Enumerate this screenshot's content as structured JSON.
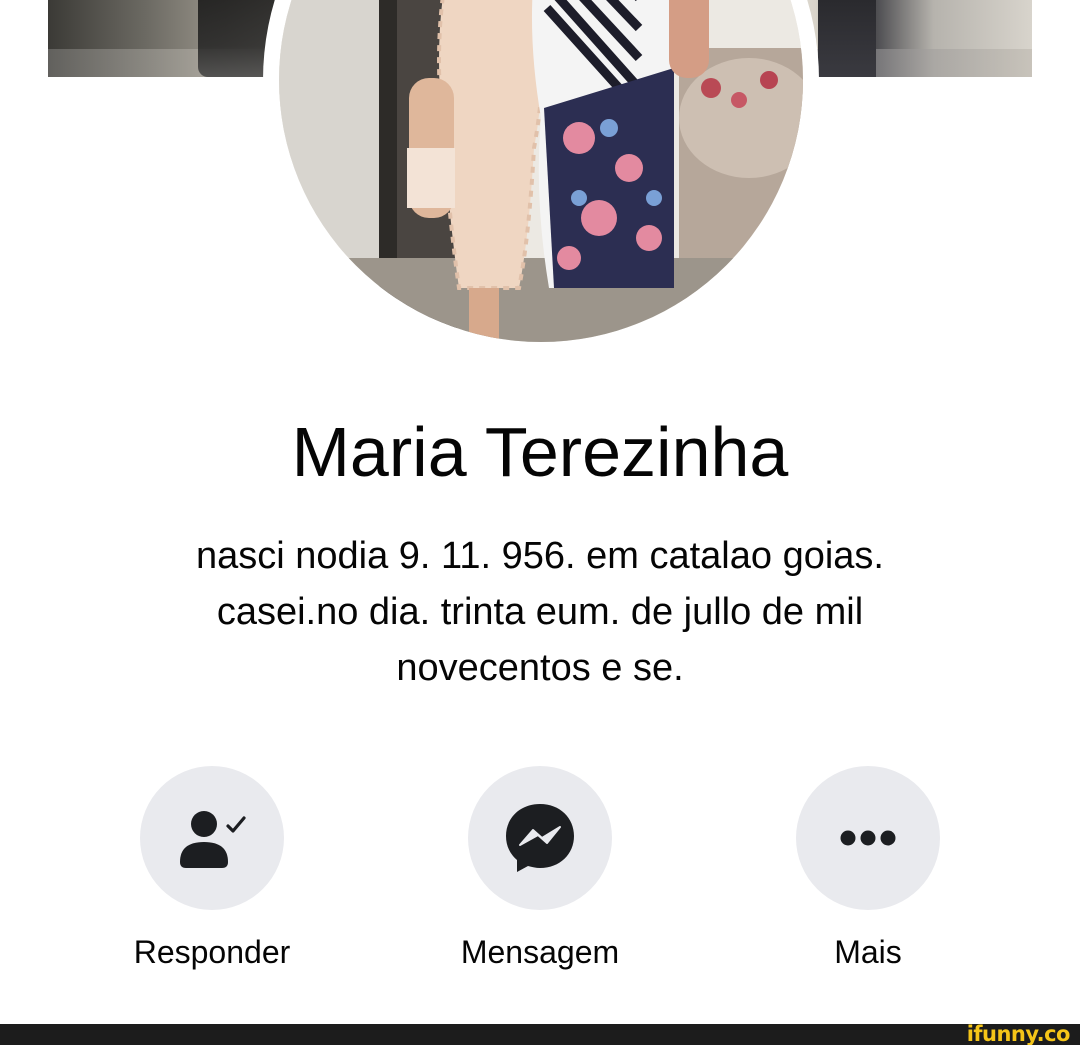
{
  "profile": {
    "name": "Maria Terezinha",
    "bio_lines": [
      "nasci nodia 9. 11. 956. em catalao goias.",
      "casei.no dia. trinta eum.  de jullo de mil",
      "novecentos e se."
    ]
  },
  "actions": [
    {
      "label": "Responder",
      "icon": "person-check-icon"
    },
    {
      "label": "Mensagem",
      "icon": "messenger-icon"
    },
    {
      "label": "Mais",
      "icon": "more-dots-icon"
    }
  ],
  "watermark": {
    "text": "ifunny.co",
    "color": "#f5c518"
  },
  "colors": {
    "action_circle": "#e9eaee",
    "text": "#050505",
    "icon": "#1c1e21"
  }
}
